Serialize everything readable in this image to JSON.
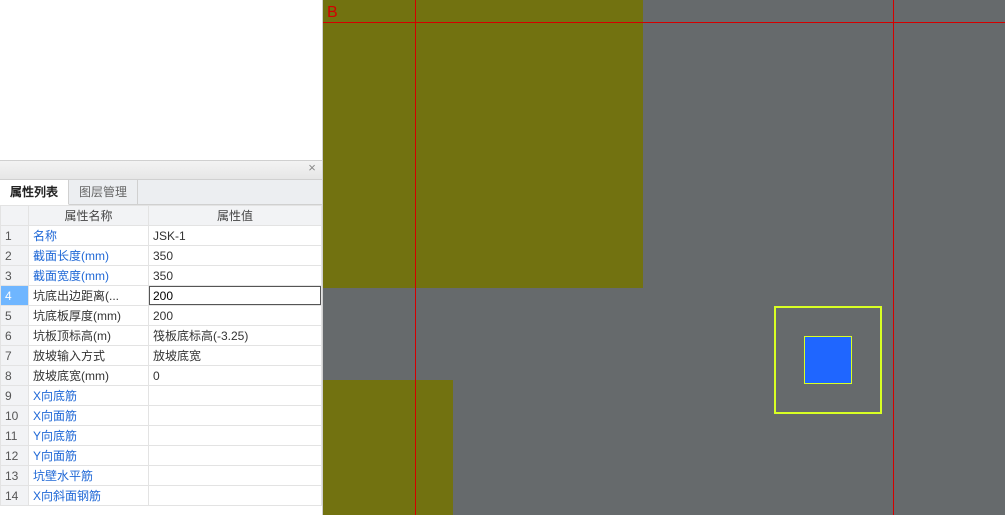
{
  "tabs": {
    "property_list": "属性列表",
    "layer_manager": "图层管理"
  },
  "panel_close_glyph": "×",
  "columns": {
    "rownum": "",
    "name": "属性名称",
    "value": "属性值"
  },
  "selected_row_index": 3,
  "rows": [
    {
      "num": "1",
      "name": "名称",
      "value": "JSK-1",
      "link": true
    },
    {
      "num": "2",
      "name": "截面长度(mm)",
      "value": "350",
      "link": true
    },
    {
      "num": "3",
      "name": "截面宽度(mm)",
      "value": "350",
      "link": true
    },
    {
      "num": "4",
      "name": "坑底出边距离(...",
      "value": "200",
      "link": false
    },
    {
      "num": "5",
      "name": "坑底板厚度(mm)",
      "value": "200",
      "link": false
    },
    {
      "num": "6",
      "name": "坑板顶标高(m)",
      "value": "筏板底标高(-3.25)",
      "link": false
    },
    {
      "num": "7",
      "name": "放坡输入方式",
      "value": "放坡底宽",
      "link": false
    },
    {
      "num": "8",
      "name": "放坡底宽(mm)",
      "value": "0",
      "link": false
    },
    {
      "num": "9",
      "name": "X向底筋",
      "value": "",
      "link": true
    },
    {
      "num": "10",
      "name": "X向面筋",
      "value": "",
      "link": true
    },
    {
      "num": "11",
      "name": "Y向底筋",
      "value": "",
      "link": true
    },
    {
      "num": "12",
      "name": "Y向面筋",
      "value": "",
      "link": true
    },
    {
      "num": "13",
      "name": "坑壁水平筋",
      "value": "",
      "link": true
    },
    {
      "num": "14",
      "name": "X向斜面钢筋",
      "value": "",
      "link": true
    }
  ],
  "canvas": {
    "axis_label_b": "B"
  }
}
